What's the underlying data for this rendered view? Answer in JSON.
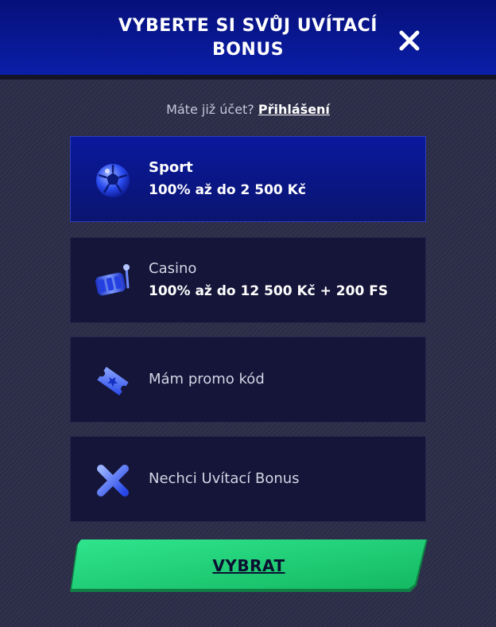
{
  "header": {
    "title": "VYBERTE SI SVŮJ UVÍTACÍ BONUS"
  },
  "login": {
    "prompt": "Máte již účet?",
    "link": "Přihlášení"
  },
  "options": [
    {
      "title": "Sport",
      "subtitle": "100% až do 2 500 Kč",
      "icon": "soccer-ball-icon",
      "selected": true
    },
    {
      "title": "Casino",
      "subtitle": "100% až do 12 500 Kč + 200 FS",
      "icon": "slot-reel-icon",
      "selected": false
    },
    {
      "title": "Mám promo kód",
      "icon": "ticket-icon",
      "selected": false
    },
    {
      "title": "Nechci Uvítací Bonus",
      "icon": "x-mark-icon",
      "selected": false
    }
  ],
  "submit": {
    "label": "VYBRAT"
  },
  "colors": {
    "header": "#0a1ea8",
    "selected": "#0a189d",
    "card": "#141538",
    "cta": "#22d27a",
    "background": "#2a2b46"
  }
}
